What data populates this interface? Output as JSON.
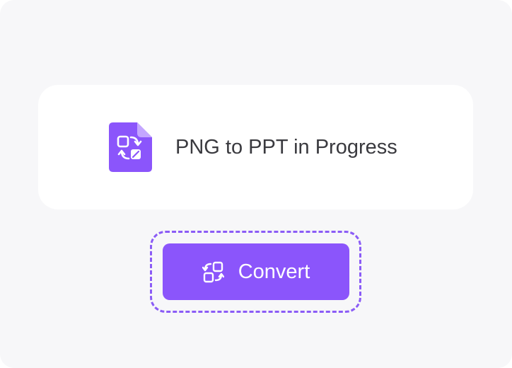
{
  "status_card": {
    "icon": "png-to-ppt-file-icon",
    "text": "PNG to PPT in Progress"
  },
  "convert_button": {
    "icon": "convert-arrows-icon",
    "label": "Convert"
  },
  "colors": {
    "background": "#f7f7f9",
    "card": "#ffffff",
    "accent": "#8b55fb",
    "focus_ring": "#8b5cf6",
    "text": "#3a3a3f"
  }
}
